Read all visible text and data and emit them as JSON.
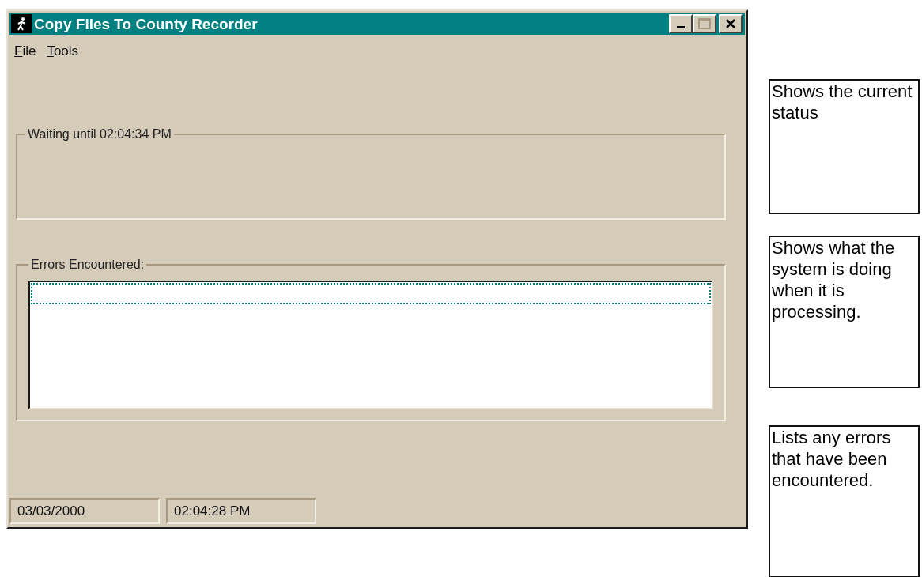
{
  "window": {
    "title": "Copy Files To County Recorder"
  },
  "menu": [
    {
      "label": "File"
    },
    {
      "label": "Tools"
    }
  ],
  "status_group": {
    "label": "Waiting until 02:04:34 PM"
  },
  "errors_group": {
    "label": "Errors Encountered:",
    "list_focused": true
  },
  "status_bar": [
    "03/03/2000",
    "02:04:28 PM"
  ],
  "callouts": [
    {
      "text": "Shows the current status"
    },
    {
      "text": "Shows what the system is doing when it is processing."
    },
    {
      "text": "Lists any errors that have been encountered."
    }
  ]
}
